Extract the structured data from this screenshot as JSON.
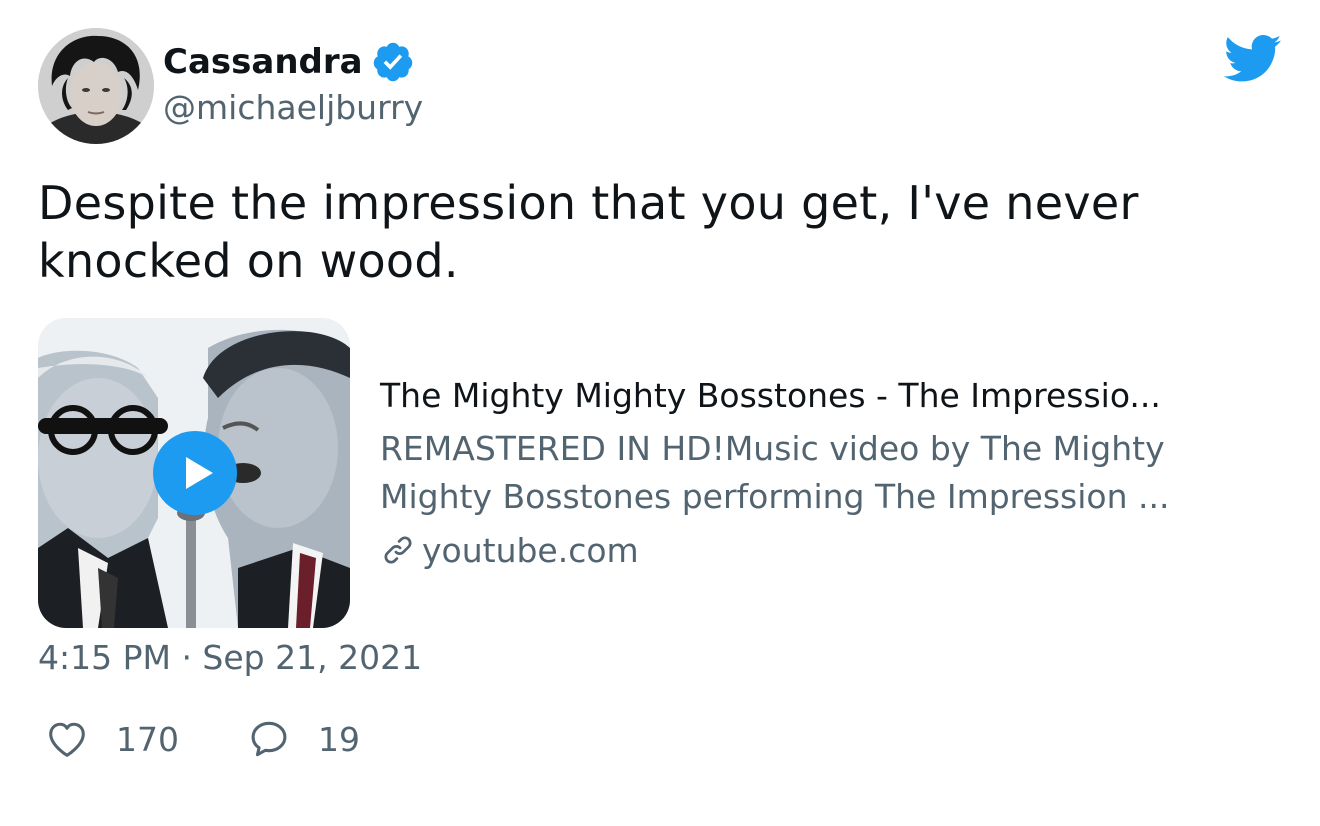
{
  "author": {
    "name": "Cassandra",
    "handle": "@michaeljburry",
    "verified": true,
    "avatar_icon": "avatar-photo"
  },
  "tweet": {
    "text": "Despite the impression that you get, I've never knocked on wood.",
    "timestamp": "4:15 PM · Sep 21, 2021"
  },
  "card": {
    "title": "The Mighty Mighty Bosstones - The Impressio...",
    "description_line1": "REMASTERED IN HD!Music video by The Mighty",
    "description_line2": "Mighty Bosstones performing The Impression ...",
    "domain": "youtube.com",
    "thumbnail_icon": "video-thumbnail",
    "play_icon": "play-icon",
    "link_icon": "link-icon"
  },
  "actions": {
    "like_count": "170",
    "reply_count": "19",
    "like_icon": "heart-icon",
    "reply_icon": "reply-bubble-icon"
  },
  "brand": {
    "icon": "twitter-bird-icon",
    "accent": "#1d9bf0",
    "secondary_text": "#536471",
    "primary_text": "#0f1419"
  }
}
